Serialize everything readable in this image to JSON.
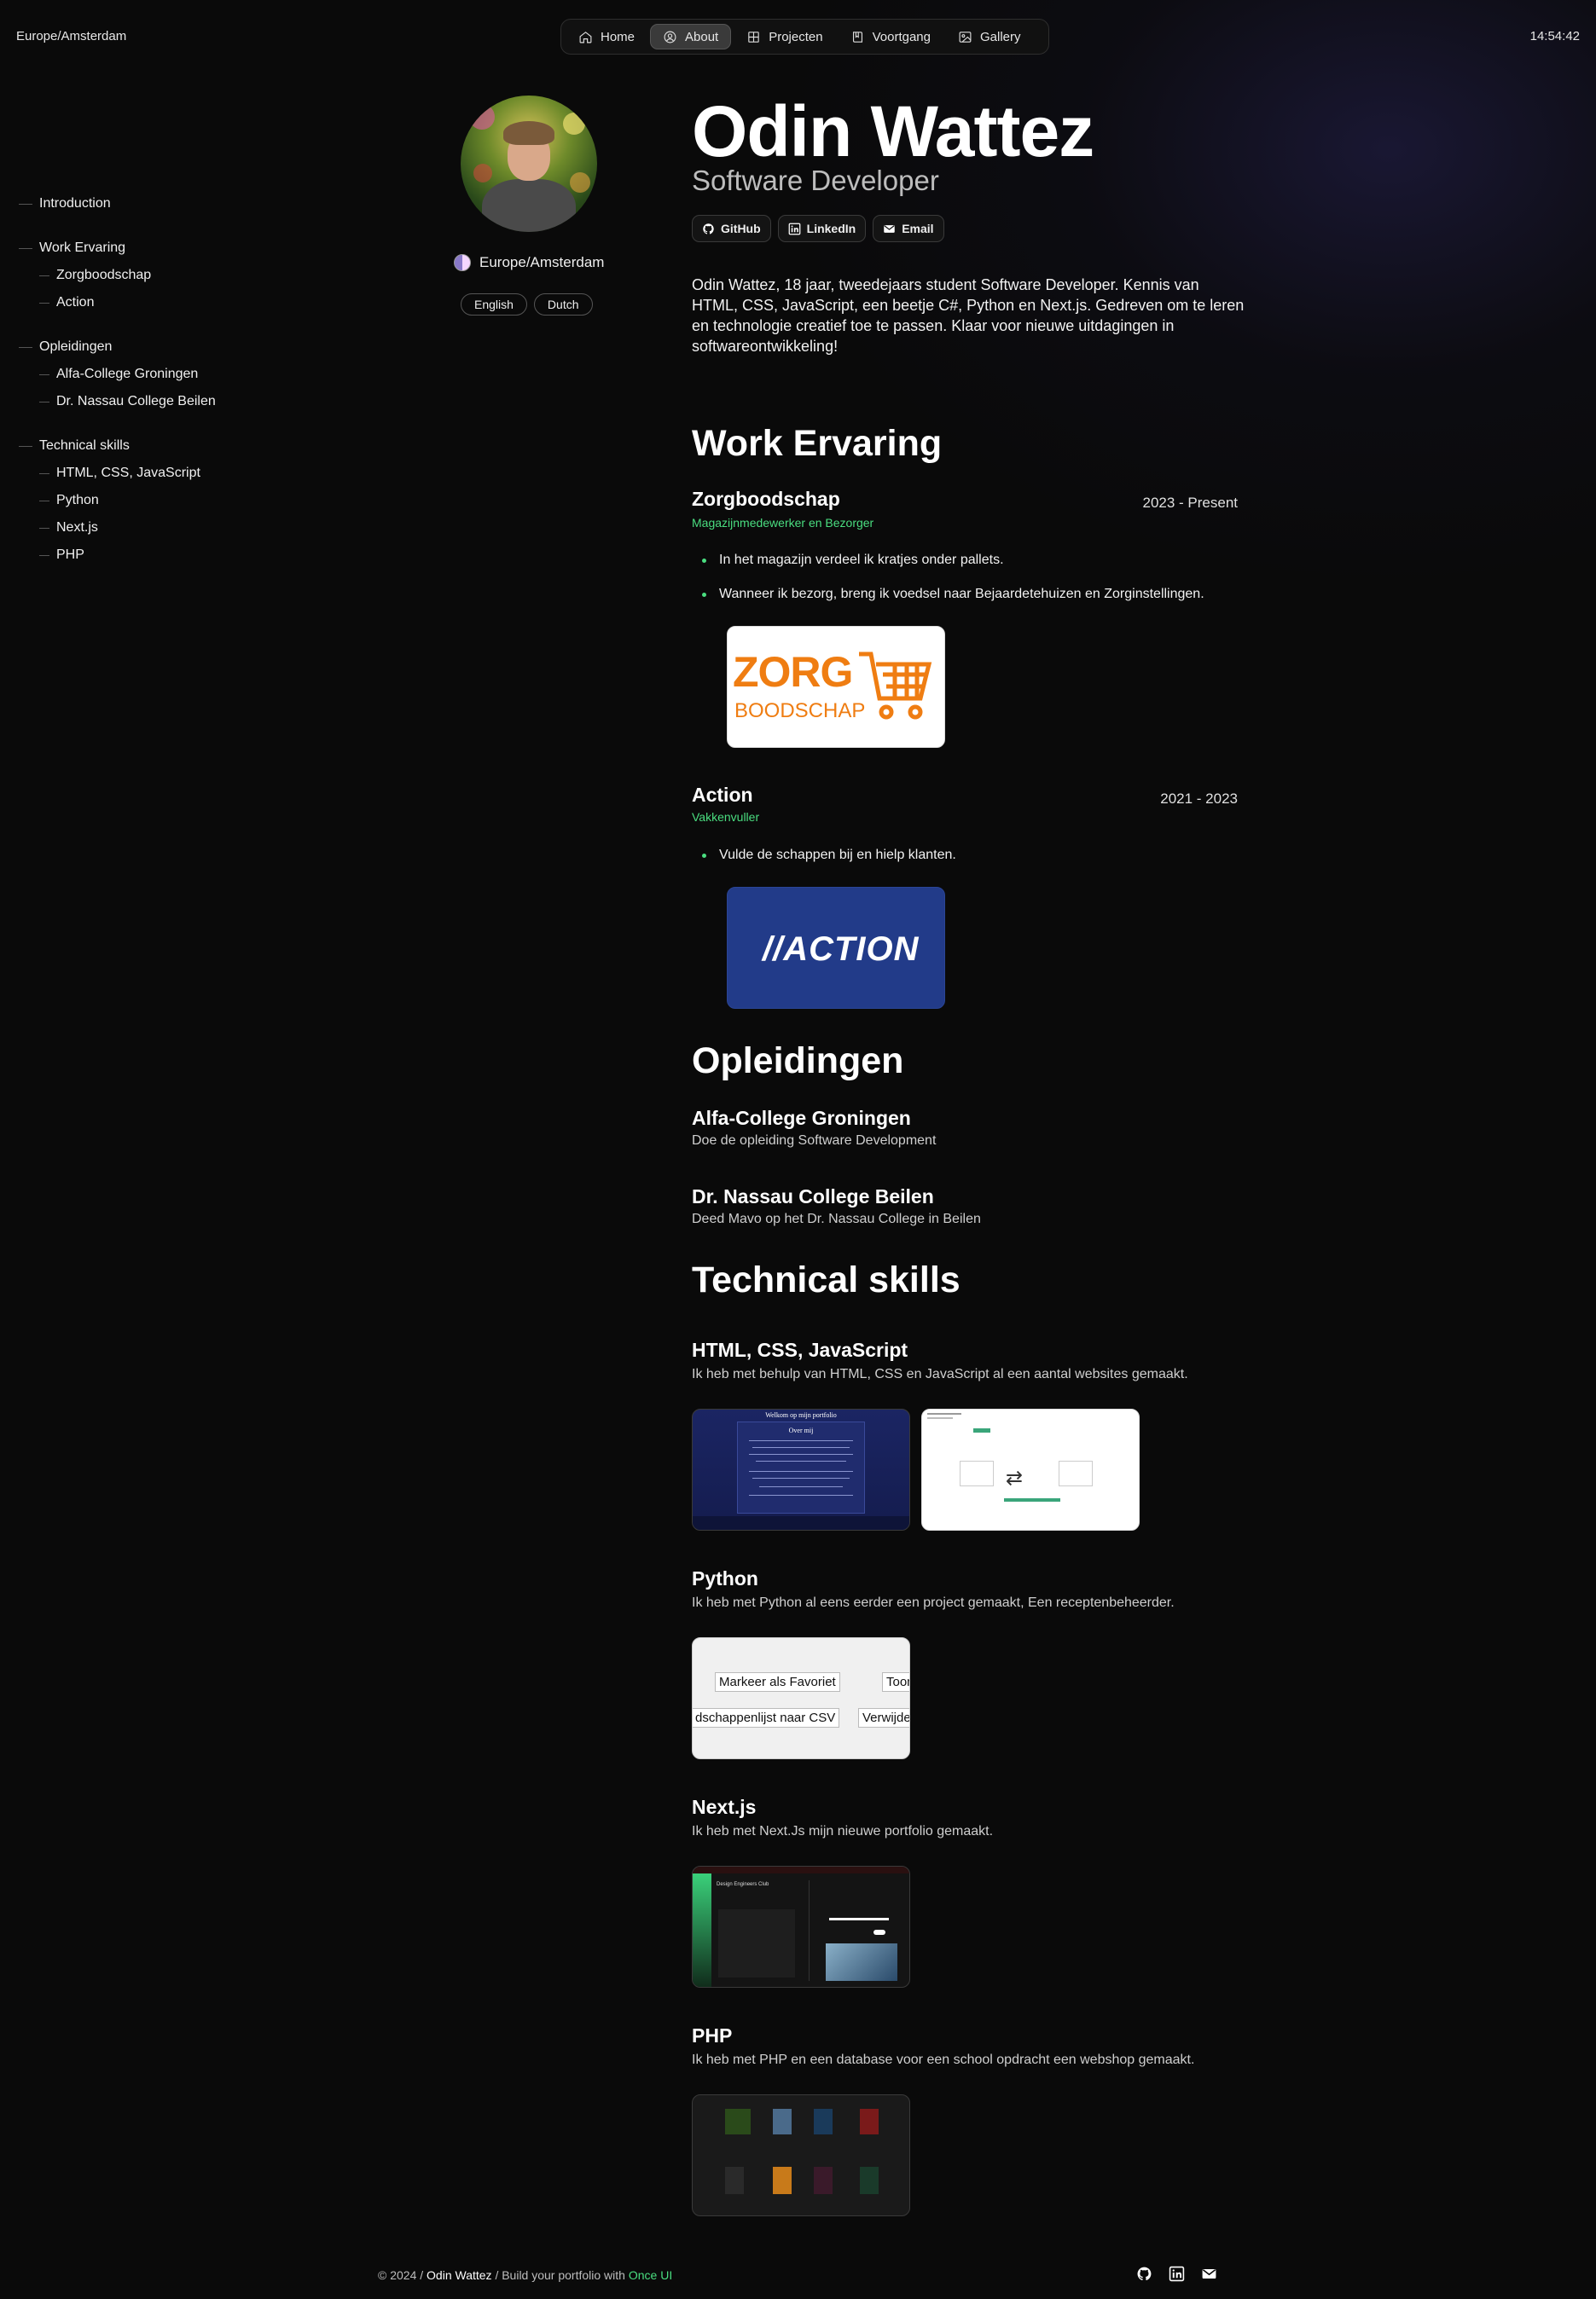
{
  "header": {
    "timezone": "Europe/Amsterdam",
    "time": "14:54:42",
    "nav": [
      {
        "label": "Home",
        "icon": "home-icon"
      },
      {
        "label": "About",
        "icon": "person-icon",
        "active": true
      },
      {
        "label": "Projecten",
        "icon": "grid-icon"
      },
      {
        "label": "Voortgang",
        "icon": "book-icon"
      },
      {
        "label": "Gallery",
        "icon": "image-icon"
      }
    ]
  },
  "toc": [
    {
      "label": "Introduction"
    },
    {
      "label": "Work Ervaring"
    },
    {
      "label": "Zorgboodschap"
    },
    {
      "label": "Action"
    },
    {
      "label": "Opleidingen"
    },
    {
      "label": "Alfa-College Groningen"
    },
    {
      "label": "Dr. Nassau College Beilen"
    },
    {
      "label": "Technical skills"
    },
    {
      "label": "HTML, CSS, JavaScript"
    },
    {
      "label": "Python"
    },
    {
      "label": "Next.js"
    },
    {
      "label": "PHP"
    }
  ],
  "profile": {
    "location": "Europe/Amsterdam",
    "languages": [
      "English",
      "Dutch"
    ]
  },
  "intro": {
    "name": "Odin Wattez",
    "role": "Software Developer",
    "socials": [
      {
        "label": "GitHub",
        "icon": "github-icon"
      },
      {
        "label": "LinkedIn",
        "icon": "linkedin-icon"
      },
      {
        "label": "Email",
        "icon": "email-icon"
      }
    ],
    "bio": "Odin Wattez, 18 jaar, tweedejaars student Software Developer. Kennis van HTML, CSS, JavaScript, een beetje C#, Python en Next.js. Gedreven om te leren en technologie creatief toe te passen. Klaar voor nieuwe uitdagingen in softwareontwikkeling!"
  },
  "work": {
    "title": "Work Ervaring",
    "jobs": [
      {
        "company": "Zorgboodschap",
        "period": "2023 - Present",
        "role": "Magazijnmedewerker en Bezorger",
        "bullets": [
          "In het magazijn verdeel ik kratjes onder pallets.",
          "Wanneer ik bezorg, breng ik voedsel naar Bejaardetehuizen en Zorginstellingen."
        ],
        "logo_text_1": "ZORG",
        "logo_text_2": "BOODSCHAP"
      },
      {
        "company": "Action",
        "period": "2021 - 2023",
        "role": "Vakkenvuller",
        "bullets": [
          "Vulde de schappen bij en hielp klanten."
        ],
        "logo_text": "//ACTION"
      }
    ]
  },
  "education": {
    "title": "Opleidingen",
    "schools": [
      {
        "name": "Alfa-College Groningen",
        "desc": "Doe de opleiding Software Development"
      },
      {
        "name": "Dr. Nassau College Beilen",
        "desc": "Deed Mavo op het Dr. Nassau College in Beilen"
      }
    ]
  },
  "skills": {
    "title": "Technical skills",
    "items": [
      {
        "name": "HTML, CSS, JavaScript",
        "desc": "Ik heb met behulp van HTML, CSS en JavaScript al een aantal websites gemaakt.",
        "shot1_title": "Welkom op mijn portfolio",
        "shot1_sub": "Over mij"
      },
      {
        "name": "Python",
        "desc": "Ik heb met Python al eens eerder een project gemaakt, Een receptenbeheerder.",
        "btn1": "Markeer als Favoriet",
        "btn2": "Toon",
        "btn3": "dschappenlijst naar CSV",
        "btn4": "Verwijde"
      },
      {
        "name": "Next.js",
        "desc": "Ik heb met Next.Js mijn nieuwe portfolio gemaakt.",
        "shot_title": "Design Engineers Club"
      },
      {
        "name": "PHP",
        "desc": "Ik heb met PHP en een database voor een school opdracht een webshop gemaakt."
      }
    ]
  },
  "footer": {
    "copyright": "© 2024 /",
    "name": "Odin Wattez",
    "middle": "/ Build your portfolio with",
    "link": "Once UI"
  },
  "colors": {
    "accent": "#4ade80",
    "background": "#0a0a0a",
    "zorg_orange": "#ef7d12",
    "action_blue": "#223b89"
  }
}
